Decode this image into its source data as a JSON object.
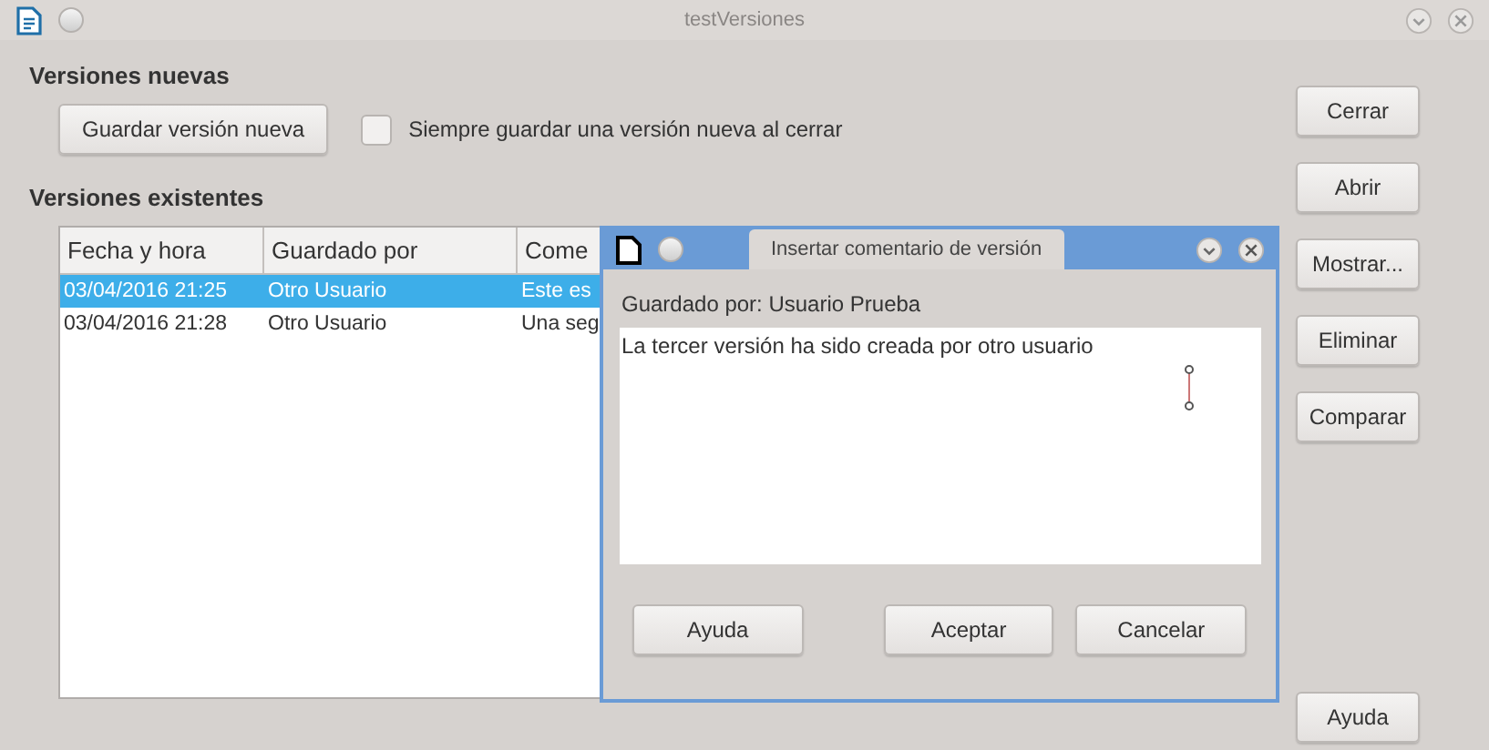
{
  "window": {
    "title": "testVersiones"
  },
  "new_versions": {
    "heading": "Versiones nuevas",
    "save_button": "Guardar versión nueva",
    "always_save": {
      "label": "Siempre guardar una versión nueva al cerrar",
      "checked": false
    }
  },
  "existing_versions": {
    "heading": "Versiones existentes",
    "table": {
      "columns": [
        "Fecha y hora",
        "Guardado por",
        "Come"
      ],
      "rows": [
        {
          "cells": [
            "03/04/2016 21:25",
            "Otro Usuario",
            "Este es"
          ],
          "selected": true
        },
        {
          "cells": [
            "03/04/2016 21:28",
            "Otro Usuario",
            "Una seg"
          ],
          "selected": false
        }
      ]
    }
  },
  "side_buttons": [
    "Cerrar",
    "Abrir",
    "Mostrar...",
    "Eliminar",
    "Comparar"
  ],
  "help_button": "Ayuda",
  "dialog": {
    "title": "Insertar comentario de versión",
    "saved_by": "Guardado por: Usuario Prueba",
    "comment": "La tercer versión ha sido creada por otro usuario",
    "buttons": [
      "Ayuda",
      "Aceptar",
      "Cancelar"
    ]
  }
}
